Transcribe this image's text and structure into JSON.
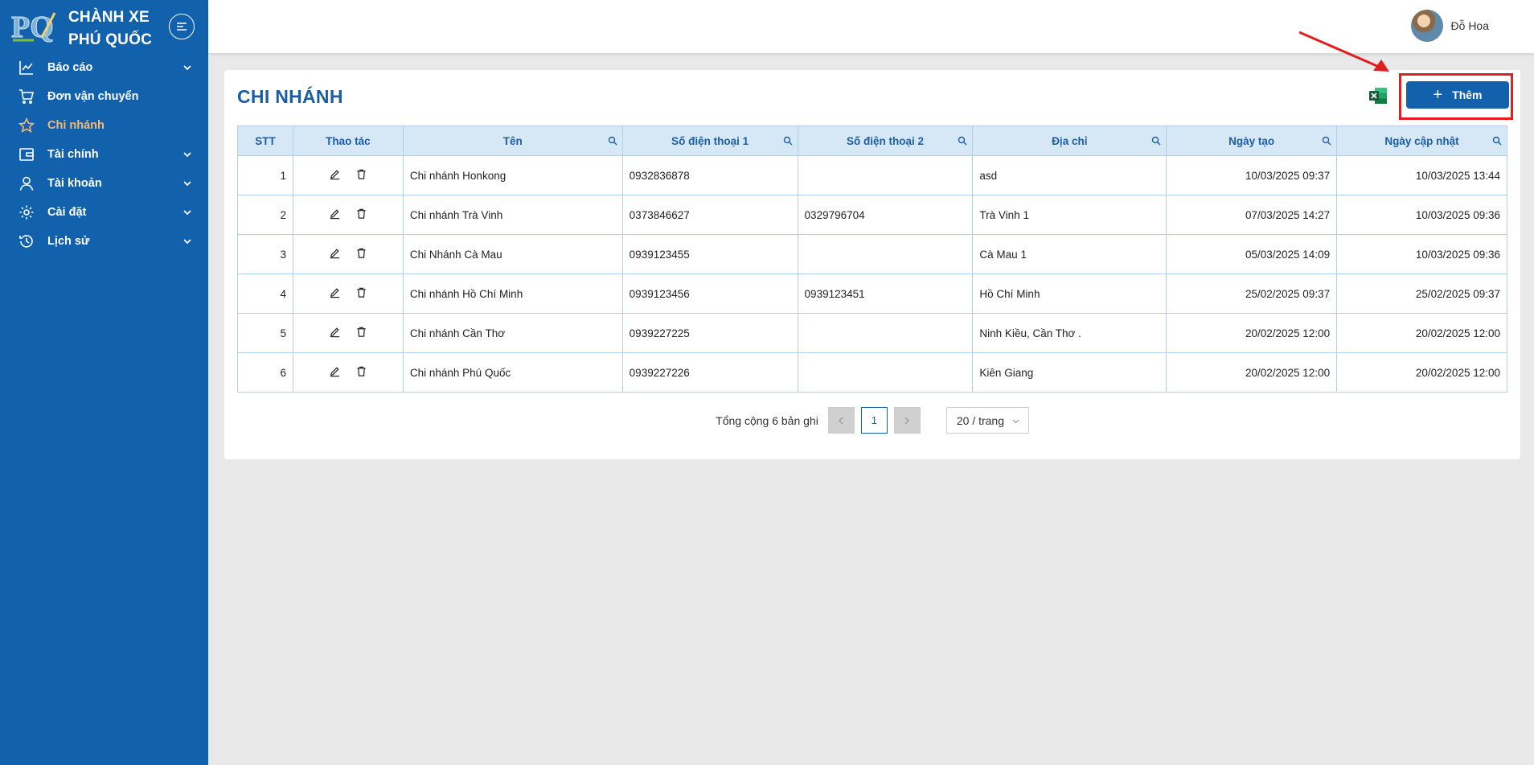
{
  "brand": {
    "line1": "CHÀNH XE",
    "line2": "PHÚ QUỐC",
    "logo_text": "PQ"
  },
  "sidebar": {
    "items": [
      {
        "label": "Báo cáo",
        "icon": "chart-line-icon",
        "has_children": true,
        "active": false
      },
      {
        "label": "Đơn vận chuyển",
        "icon": "cart-icon",
        "has_children": false,
        "active": false
      },
      {
        "label": "Chi nhánh",
        "icon": "star-icon",
        "has_children": false,
        "active": true
      },
      {
        "label": "Tài chính",
        "icon": "wallet-icon",
        "has_children": true,
        "active": false
      },
      {
        "label": "Tài khoản",
        "icon": "user-icon",
        "has_children": true,
        "active": false
      },
      {
        "label": "Cài đặt",
        "icon": "gear-icon",
        "has_children": true,
        "active": false
      },
      {
        "label": "Lịch sử",
        "icon": "history-icon",
        "has_children": true,
        "active": false
      }
    ]
  },
  "header": {
    "user_name": "Đỗ Hoa"
  },
  "page": {
    "title": "CHI NHÁNH",
    "add_label": "Thêm"
  },
  "table": {
    "columns": [
      "STT",
      "Thao tác",
      "Tên",
      "Số điện thoại 1",
      "Số điện thoại 2",
      "Địa chỉ",
      "Ngày tạo",
      "Ngày cập nhật"
    ],
    "rows": [
      {
        "stt": "1",
        "name": "Chi nhánh Honkong",
        "phone1": "0932836878",
        "phone2": "",
        "address": "asd",
        "created": "10/03/2025 09:37",
        "updated": "10/03/2025 13:44"
      },
      {
        "stt": "2",
        "name": "Chi nhánh Trà Vinh",
        "phone1": "0373846627",
        "phone2": "0329796704",
        "address": "Trà Vinh 1",
        "created": "07/03/2025 14:27",
        "updated": "10/03/2025 09:36"
      },
      {
        "stt": "3",
        "name": "Chi Nhánh Cà Mau",
        "phone1": "0939123455",
        "phone2": "",
        "address": "Cà Mau 1",
        "created": "05/03/2025 14:09",
        "updated": "10/03/2025 09:36"
      },
      {
        "stt": "4",
        "name": "Chi nhánh Hồ Chí Minh",
        "phone1": "0939123456",
        "phone2": "0939123451",
        "address": "Hồ Chí Minh",
        "created": "25/02/2025 09:37",
        "updated": "25/02/2025 09:37"
      },
      {
        "stt": "5",
        "name": "Chi nhánh Cần Thơ",
        "phone1": "0939227225",
        "phone2": "",
        "address": "Ninh Kiều, Cần Thơ .",
        "created": "20/02/2025 12:00",
        "updated": "20/02/2025 12:00"
      },
      {
        "stt": "6",
        "name": "Chi nhánh Phú Quốc",
        "phone1": "0939227226",
        "phone2": "",
        "address": "Kiên Giang",
        "created": "20/02/2025 12:00",
        "updated": "20/02/2025 12:00"
      }
    ]
  },
  "pagination": {
    "total_text": "Tổng cộng 6 bản ghi",
    "current_page": "1",
    "page_size": "20 / trang",
    "prev": "<",
    "next": ">"
  },
  "colors": {
    "sidebar": "#1261ad",
    "accent": "#1b5ea6",
    "active_menu": "#f5b971",
    "annotation": "#e02020"
  }
}
